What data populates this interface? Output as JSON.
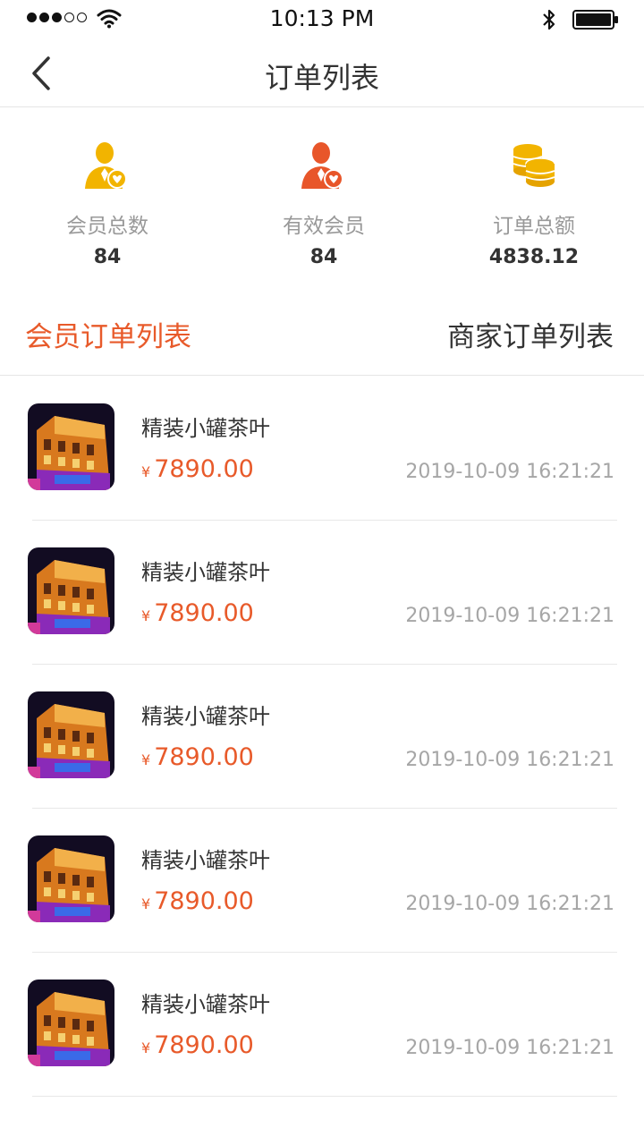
{
  "status_bar": {
    "time": "10:13 PM"
  },
  "nav": {
    "title": "订单列表"
  },
  "stats": [
    {
      "label": "会员总数",
      "value": "84",
      "icon": "member-user-icon",
      "color": "#f2b400"
    },
    {
      "label": "有效会员",
      "value": "84",
      "icon": "valid-member-icon",
      "color": "#e8562a"
    },
    {
      "label": "订单总额",
      "value": "4838.12",
      "icon": "coins-icon",
      "color": "#f2b400"
    }
  ],
  "tabs": {
    "member": "会员订单列表",
    "merchant": "商家订单列表"
  },
  "orders": [
    {
      "name": "精装小罐茶叶",
      "currency": "¥",
      "price": "7890.00",
      "time": "2019-10-09 16:21:21"
    },
    {
      "name": "精装小罐茶叶",
      "currency": "¥",
      "price": "7890.00",
      "time": "2019-10-09 16:21:21"
    },
    {
      "name": "精装小罐茶叶",
      "currency": "¥",
      "price": "7890.00",
      "time": "2019-10-09 16:21:21"
    },
    {
      "name": "精装小罐茶叶",
      "currency": "¥",
      "price": "7890.00",
      "time": "2019-10-09 16:21:21"
    },
    {
      "name": "精装小罐茶叶",
      "currency": "¥",
      "price": "7890.00",
      "time": "2019-10-09 16:21:21"
    }
  ],
  "colors": {
    "accent": "#e85a2a",
    "muted": "#999999",
    "gold": "#f2b400"
  }
}
